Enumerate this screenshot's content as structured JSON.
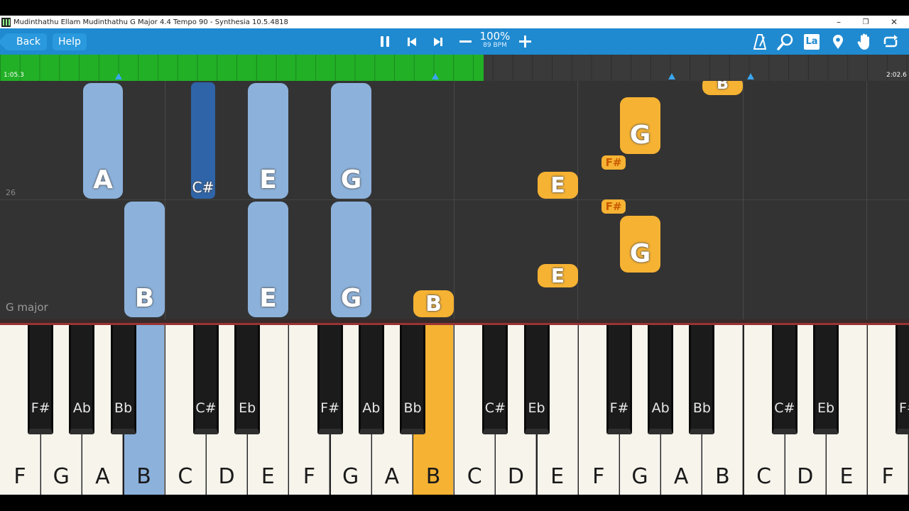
{
  "window": {
    "title": "Mudinthathu Ellam Mudinthathu G Major 4.4 Tempo 90 - Synthesia 10.5.4818",
    "minimize": "–",
    "restore": "❐",
    "close": "✕"
  },
  "toolbar": {
    "back_label": "Back",
    "help_label": "Help",
    "tempo_percent": "100%",
    "tempo_bpm": "89 BPM",
    "language_label": "La",
    "icons": [
      "pause-icon",
      "skip-back-icon",
      "skip-forward-icon",
      "minus-icon",
      "plus-icon",
      "metronome-icon",
      "search-icon",
      "language-icon",
      "location-pin-icon",
      "hand-icon",
      "loop-icon"
    ]
  },
  "timeline": {
    "current_time": "1:05.3",
    "total_time": "2:02.6",
    "progress_fraction": 0.532,
    "progress_color": "#22b026",
    "marker_color": "#3aa6f0"
  },
  "notefield": {
    "measure_number": "26",
    "key_signature": "G major",
    "left_hand_color": "#8cb2dc",
    "right_hand_color": "#f6b233",
    "notes": [
      {
        "label": "A",
        "hand": "left"
      },
      {
        "label": "C#",
        "hand": "left"
      },
      {
        "label": "E",
        "hand": "left"
      },
      {
        "label": "G",
        "hand": "left"
      },
      {
        "label": "B",
        "hand": "left"
      },
      {
        "label": "E",
        "hand": "left"
      },
      {
        "label": "G",
        "hand": "left"
      },
      {
        "label": "B",
        "hand": "right"
      },
      {
        "label": "E",
        "hand": "right"
      },
      {
        "label": "E",
        "hand": "right"
      },
      {
        "label": "G",
        "hand": "right"
      },
      {
        "label": "F#",
        "hand": "right"
      },
      {
        "label": "F#",
        "hand": "right"
      },
      {
        "label": "G",
        "hand": "right"
      },
      {
        "label": "B",
        "hand": "right"
      }
    ]
  },
  "keyboard": {
    "white_keys": [
      "F",
      "G",
      "A",
      "B",
      "C",
      "D",
      "E",
      "F",
      "G",
      "A",
      "B",
      "C",
      "D",
      "E",
      "F",
      "G",
      "A",
      "B",
      "C",
      "D",
      "E",
      "F"
    ],
    "black_keys": [
      "F#",
      "Ab",
      "Bb",
      "C#",
      "Eb",
      "F#",
      "Ab",
      "Bb",
      "C#",
      "Eb",
      "F#",
      "Ab",
      "Bb",
      "C#",
      "Eb",
      "F#"
    ],
    "pressed": [
      {
        "white_index": 3,
        "note": "B",
        "hand": "left"
      },
      {
        "white_index": 10,
        "note": "B",
        "hand": "right"
      }
    ]
  }
}
